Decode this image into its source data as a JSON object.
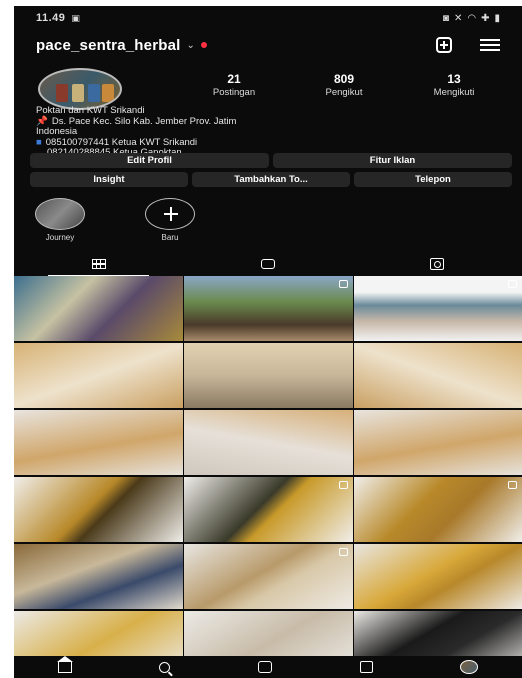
{
  "status_bar": {
    "time": "11.49",
    "left_icon": "image-icon",
    "right_icons": [
      "mute-icon",
      "wifi-icon",
      "signal-icon",
      "battery-icon"
    ]
  },
  "header": {
    "username": "pace_sentra_herbal",
    "has_notification_dot": true,
    "accent_dot_color": "#ff3040"
  },
  "profile": {
    "stats": [
      {
        "value": "21",
        "label": "Postingan"
      },
      {
        "value": "809",
        "label": "Pengikut"
      },
      {
        "value": "13",
        "label": "Mengikuti"
      }
    ],
    "bio": {
      "name": "Poktan dan KWT Srikandi",
      "location": "Ds. Pace Kec. Silo Kab. Jember Prov. Jatim",
      "country": "Indonesia",
      "phone1": "085100797441 Ketua KWT Srikandi",
      "phone2": "082140288845 Ketua Gapoktan"
    }
  },
  "buttons_row1": {
    "edit": "Edit Profil",
    "ads": "Fitur Iklan"
  },
  "buttons_row2": {
    "insight": "Insight",
    "add": "Tambahkan To...",
    "call": "Telepon"
  },
  "highlights": [
    {
      "label": "Journey"
    },
    {
      "label": "Baru"
    }
  ],
  "tabs": [
    "grid-icon",
    "reels-icon",
    "tagged-icon"
  ],
  "grid_posts_count": 18,
  "colors": {
    "background": "#0b0b0b",
    "button": "#262626",
    "pin": "#e03c3c",
    "blue_square": "#3b7bd9"
  }
}
